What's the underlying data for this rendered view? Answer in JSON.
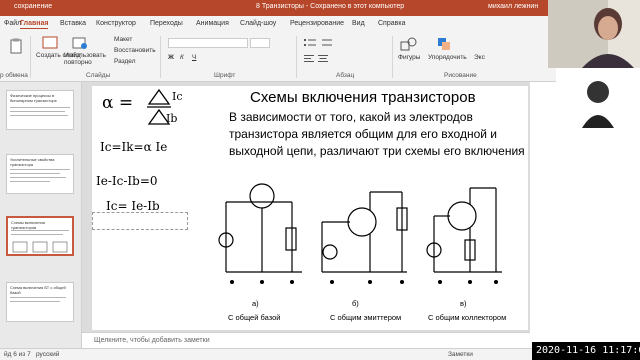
{
  "titlebar": {
    "autosave": "сохранение",
    "doc_title": "8 Транзисторы  -  Сохранено в этот компьютер",
    "user": "михаил лежнин"
  },
  "tabs": [
    "Файл",
    "Главная",
    "Вставка",
    "Конструктор",
    "Переходы",
    "Анимация",
    "Слайд-шоу",
    "Рецензирование",
    "Вид",
    "Справка"
  ],
  "ribbon": {
    "create_slide": "Создать слайд",
    "reuse": "Использовать повторно",
    "layout": "Макет",
    "restore": "Восстановить",
    "section": "Раздел",
    "group_clipboard": "р обмена",
    "group_slides": "Слайды",
    "group_font": "Шрифт",
    "group_paragraph": "Абзац",
    "group_drawing": "Рисование",
    "shapes": "Фигуры",
    "arrange": "Упорядочить",
    "quick": "Экс"
  },
  "thumbnails": [
    {
      "num": "",
      "title": "Физические процессы в биполярном транзисторе"
    },
    {
      "num": "",
      "title": "Усилительные свойства транзистора"
    },
    {
      "num": "",
      "title": "Схемы включения транзисторов"
    },
    {
      "num": "",
      "title": "Схема включения БТ с общей базой"
    }
  ],
  "slide": {
    "title": "Схемы включения транзисторов",
    "body": "В зависимости от того, какой из электродов транзистора является общим для его входной и выходной цепи, различают три схемы его включения",
    "hw_alpha": "α =",
    "hw_ic": "Ic",
    "hw_ib": "Ib",
    "hw_eq1": "Ic=Ik=α Ie",
    "hw_eq2": "Ie-Ic-Ib=0",
    "hw_eq3": "Ic=  Ie-Ib",
    "cap_a": "а)",
    "cap_b": "б)",
    "cap_c": "в)",
    "label_a": "С общей базой",
    "label_b": "С общим эмиттером",
    "label_c": "С общим коллектором"
  },
  "notes": {
    "placeholder": "Щелкните, чтобы добавить заметки"
  },
  "status": {
    "slide_info": "йд 6 из 7",
    "lang": "русский",
    "notes_btn": "Заметки"
  },
  "clock": "2020-11-16  11:17:02"
}
